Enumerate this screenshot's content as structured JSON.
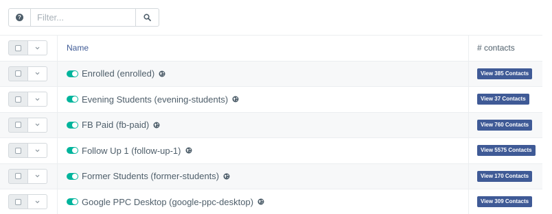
{
  "filter": {
    "placeholder": "Filter...",
    "value": ""
  },
  "table": {
    "header": {
      "name": "Name",
      "contacts": "# contacts"
    },
    "rows": [
      {
        "name": "Enrolled (enrolled)",
        "button": "View 385 Contacts"
      },
      {
        "name": "Evening Students (evening-students)",
        "button": "View 37 Contacts"
      },
      {
        "name": "FB Paid (fb-paid)",
        "button": "View 760 Contacts"
      },
      {
        "name": "Follow Up 1 (follow-up-1)",
        "button": "View 5575 Contacts"
      },
      {
        "name": "Former Students (former-students)",
        "button": "View 170 Contacts"
      },
      {
        "name": "Google PPC Desktop (google-ppc-desktop)",
        "button": "View 309 Contacts"
      }
    ]
  },
  "colors": {
    "accent": "#3f5a96",
    "toggle_on": "#00b49c",
    "text": "#4e5e6a"
  },
  "icons": {
    "help": "question-circle-icon",
    "search": "search-icon",
    "dropdown": "chevron-down-icon",
    "public": "globe-icon",
    "published": "toggle-on-icon"
  }
}
